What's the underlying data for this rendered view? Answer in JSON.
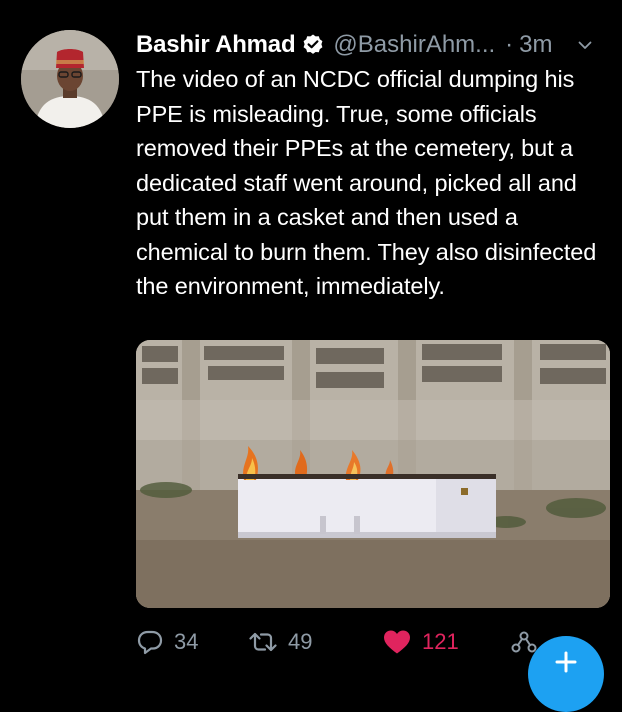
{
  "tweet": {
    "author": {
      "display_name": "Bashir Ahmad",
      "handle": "@BashirAhm...",
      "verified": true,
      "avatar_icon": "profile-photo"
    },
    "separator": "·",
    "timestamp": "3m",
    "text": "The video of an NCDC official dumping his PPE is misleading. True, some officials removed their PPEs at the cemetery, but a dedicated staff went around, picked all and put them in a casket and then used a chemical to burn them. They also disinfected the environment, immediately.",
    "media": {
      "description_icon": "photo-burning-casket"
    },
    "actions": {
      "reply_count": "34",
      "retweet_count": "49",
      "like_count": "121",
      "liked": true
    }
  },
  "colors": {
    "background": "#000000",
    "text_primary": "#ffffff",
    "text_secondary": "#8f9ba6",
    "like": "#e0245e",
    "accent": "#1da1f2"
  },
  "icons": {
    "verified": "verified-badge-icon",
    "more": "chevron-down-icon",
    "reply": "reply-icon",
    "retweet": "retweet-icon",
    "like": "heart-icon",
    "share": "share-icon",
    "compose": "compose-icon"
  }
}
